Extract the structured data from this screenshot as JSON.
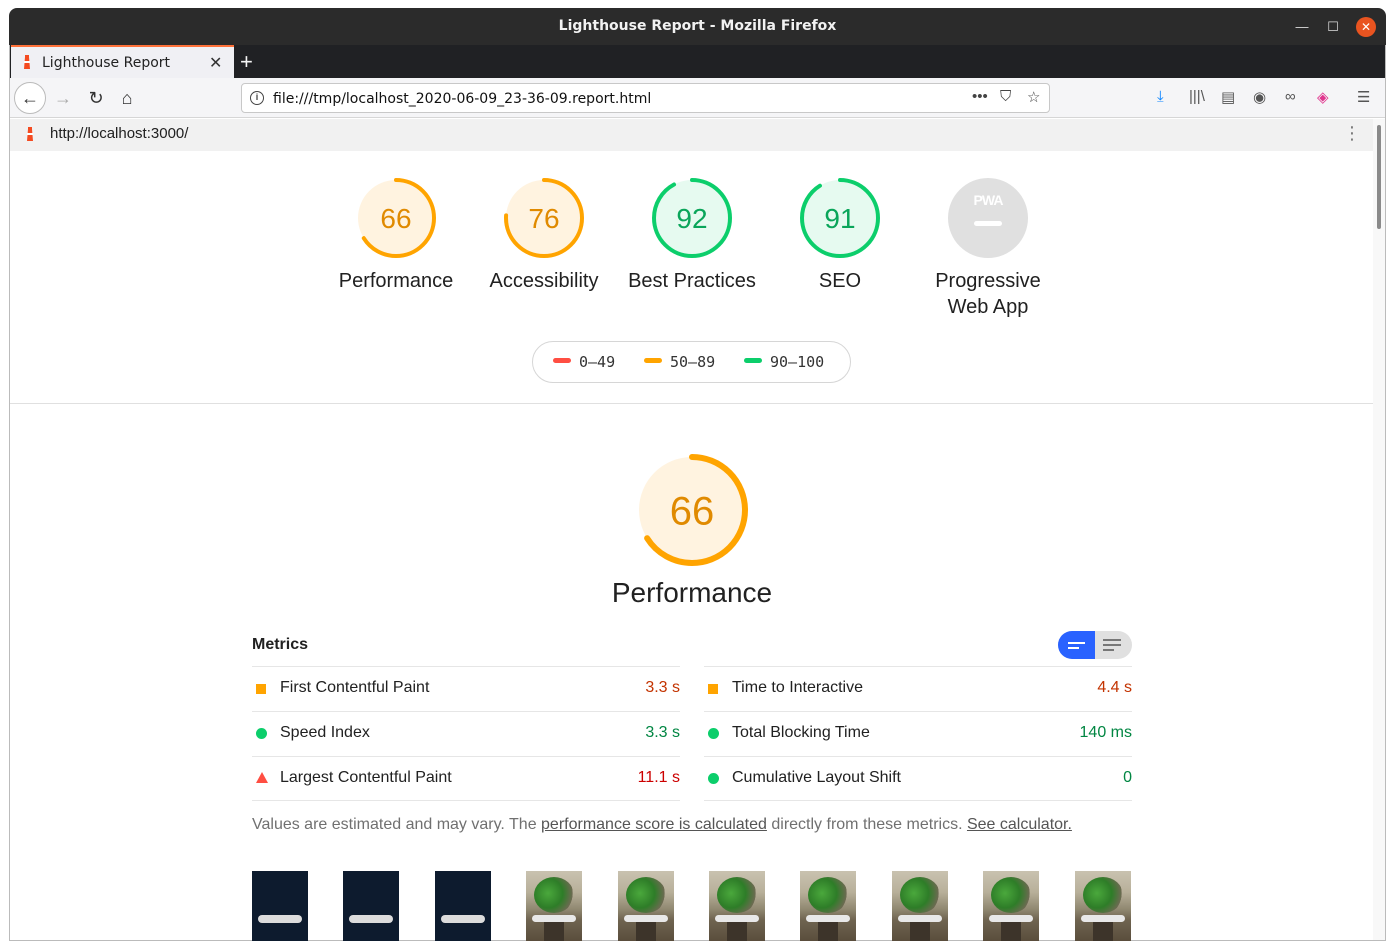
{
  "window": {
    "title": "Lighthouse Report - Mozilla Firefox"
  },
  "tab": {
    "label": "Lighthouse Report"
  },
  "urlbar": {
    "url": "file:///tmp/localhost_2020-06-09_23-36-09.report.html"
  },
  "report": {
    "url": "http://localhost:3000/"
  },
  "categories": [
    {
      "score": "66",
      "label": "Performance",
      "fraction": 0.66,
      "status": "average"
    },
    {
      "score": "76",
      "label": "Accessibility",
      "fraction": 0.76,
      "status": "average"
    },
    {
      "score": "92",
      "label": "Best Practices",
      "fraction": 0.92,
      "status": "pass"
    },
    {
      "score": "91",
      "label": "SEO",
      "fraction": 0.91,
      "status": "pass"
    },
    {
      "score": "",
      "label_line1": "Progressive",
      "label_line2": "Web App",
      "badge_text": "PWA",
      "status": "na"
    }
  ],
  "legend": [
    {
      "range": "0–49",
      "color": "#ff4e42"
    },
    {
      "range": "50–89",
      "color": "#ffa400"
    },
    {
      "range": "90–100",
      "color": "#0cce6b"
    }
  ],
  "colors": {
    "average": "#ffa400",
    "average_bg": "#fff3e0",
    "average_text": "#c33300",
    "pass": "#0cce6b",
    "pass_bg": "#e6faf0",
    "pass_text": "#018642",
    "fail": "#ff4e42"
  },
  "performance": {
    "score": "66",
    "fraction": 0.66,
    "title": "Performance",
    "metrics_heading": "Metrics",
    "metrics_left": [
      {
        "name": "First Contentful Paint",
        "value": "3.3 s",
        "status": "average"
      },
      {
        "name": "Speed Index",
        "value": "3.3 s",
        "status": "pass"
      },
      {
        "name": "Largest Contentful Paint",
        "value": "11.1 s",
        "status": "fail"
      }
    ],
    "metrics_right": [
      {
        "name": "Time to Interactive",
        "value": "4.4 s",
        "status": "average"
      },
      {
        "name": "Total Blocking Time",
        "value": "140 ms",
        "status": "pass"
      },
      {
        "name": "Cumulative Layout Shift",
        "value": "0",
        "status": "pass"
      }
    ],
    "note_prefix": "Values are estimated and may vary. The ",
    "note_link": "performance score is calculated",
    "note_middle": " directly from these metrics. ",
    "note_calc": "See calculator."
  },
  "filmstrip": [
    "dark",
    "dark",
    "dark",
    "image",
    "image",
    "image",
    "image",
    "image",
    "image",
    "image"
  ]
}
